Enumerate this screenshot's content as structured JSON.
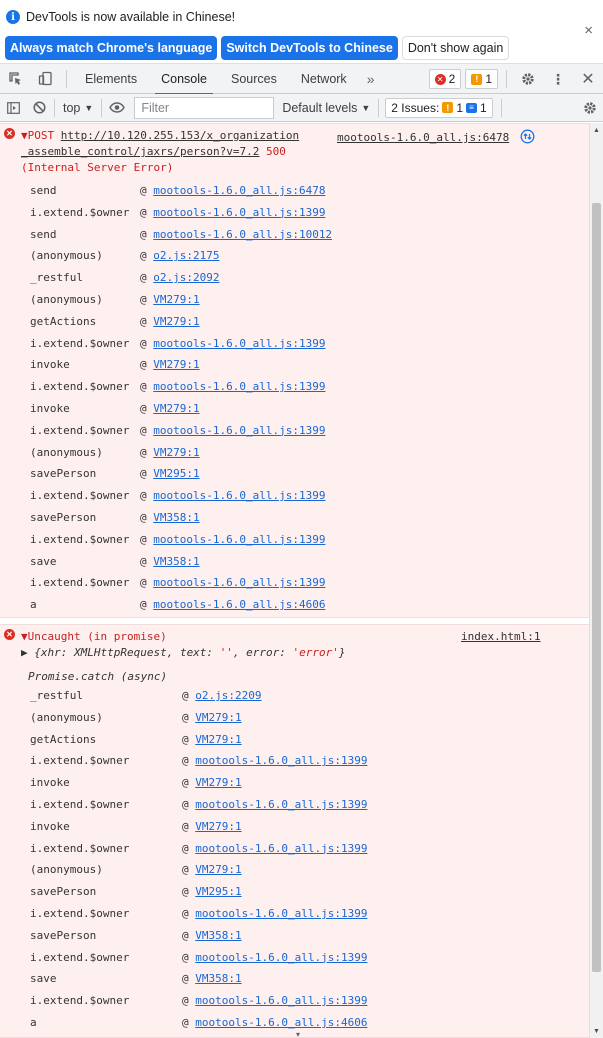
{
  "infobar": {
    "message": "DevTools is now available in Chinese!",
    "btn_match": "Always match Chrome's language",
    "btn_switch": "Switch DevTools to Chinese",
    "btn_dont_show": "Don't show again",
    "close": "×"
  },
  "tabbar": {
    "tabs": [
      "Elements",
      "Console",
      "Sources",
      "Network"
    ],
    "more": "»",
    "error_count": "2",
    "warning_count": "1"
  },
  "console_toolbar": {
    "context": "top",
    "filter_placeholder": "Filter",
    "levels": "Default levels",
    "issues_label": "2 Issues:",
    "issues_warn": "1",
    "issues_info": "1"
  },
  "entry1": {
    "prefix": "▼POST",
    "url_line1": "http://10.120.255.153/x_organization",
    "url_line2": "_assemble_control/jaxrs/person?v=7.2",
    "status": "500",
    "status_text": "(Internal Server Error)",
    "source": "mootools-1.6.0_all.js:6478",
    "frames": [
      {
        "fn": "send",
        "src": "mootools-1.6.0_all.js:6478"
      },
      {
        "fn": "i.extend.$owner",
        "src": "mootools-1.6.0_all.js:1399"
      },
      {
        "fn": "send",
        "src": "mootools-1.6.0_all.js:10012"
      },
      {
        "fn": "(anonymous)",
        "src": "o2.js:2175"
      },
      {
        "fn": "_restful",
        "src": "o2.js:2092"
      },
      {
        "fn": "(anonymous)",
        "src": "VM279:1"
      },
      {
        "fn": "getActions",
        "src": "VM279:1"
      },
      {
        "fn": "i.extend.$owner",
        "src": "mootools-1.6.0_all.js:1399"
      },
      {
        "fn": "invoke",
        "src": "VM279:1"
      },
      {
        "fn": "i.extend.$owner",
        "src": "mootools-1.6.0_all.js:1399"
      },
      {
        "fn": "invoke",
        "src": "VM279:1"
      },
      {
        "fn": "i.extend.$owner",
        "src": "mootools-1.6.0_all.js:1399"
      },
      {
        "fn": "(anonymous)",
        "src": "VM279:1"
      },
      {
        "fn": "savePerson",
        "src": "VM295:1"
      },
      {
        "fn": "i.extend.$owner",
        "src": "mootools-1.6.0_all.js:1399"
      },
      {
        "fn": "savePerson",
        "src": "VM358:1"
      },
      {
        "fn": "i.extend.$owner",
        "src": "mootools-1.6.0_all.js:1399"
      },
      {
        "fn": "save",
        "src": "VM358:1"
      },
      {
        "fn": "i.extend.$owner",
        "src": "mootools-1.6.0_all.js:1399"
      },
      {
        "fn": "a",
        "src": "mootools-1.6.0_all.js:4606"
      }
    ]
  },
  "entry2": {
    "prefix": "▼Uncaught (in promise)",
    "source": "index.html:1",
    "object_prefix": "▶ {xhr: XMLHttpRequest, text: ",
    "object_text": "''",
    "object_mid": ", error: ",
    "object_error": "'error'",
    "object_end": "}",
    "async_label": "Promise.catch (async)",
    "frames": [
      {
        "fn": "_restful",
        "src": "o2.js:2209"
      },
      {
        "fn": "(anonymous)",
        "src": "VM279:1"
      },
      {
        "fn": "getActions",
        "src": "VM279:1"
      },
      {
        "fn": "i.extend.$owner",
        "src": "mootools-1.6.0_all.js:1399"
      },
      {
        "fn": "invoke",
        "src": "VM279:1"
      },
      {
        "fn": "i.extend.$owner",
        "src": "mootools-1.6.0_all.js:1399"
      },
      {
        "fn": "invoke",
        "src": "VM279:1"
      },
      {
        "fn": "i.extend.$owner",
        "src": "mootools-1.6.0_all.js:1399"
      },
      {
        "fn": "(anonymous)",
        "src": "VM279:1"
      },
      {
        "fn": "savePerson",
        "src": "VM295:1"
      },
      {
        "fn": "i.extend.$owner",
        "src": "mootools-1.6.0_all.js:1399"
      },
      {
        "fn": "savePerson",
        "src": "VM358:1"
      },
      {
        "fn": "i.extend.$owner",
        "src": "mootools-1.6.0_all.js:1399"
      },
      {
        "fn": "save",
        "src": "VM358:1"
      },
      {
        "fn": "i.extend.$owner",
        "src": "mootools-1.6.0_all.js:1399"
      },
      {
        "fn": "a",
        "src": "mootools-1.6.0_all.js:4606"
      }
    ]
  }
}
